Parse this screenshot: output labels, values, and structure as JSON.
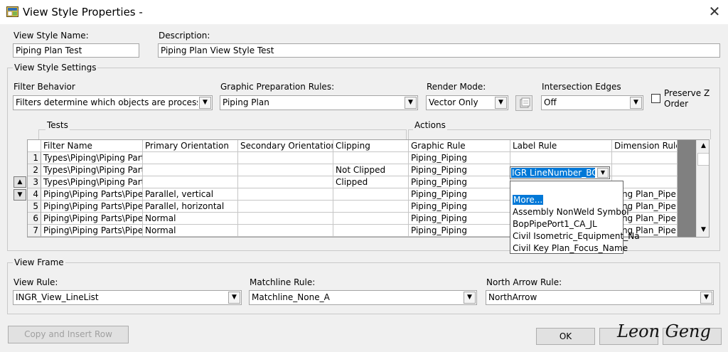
{
  "window": {
    "title": "View Style Properties -",
    "close_glyph": "✕"
  },
  "header": {
    "name_label": "View Style Name:",
    "name_value": "Piping Plan Test",
    "desc_label": "Description:",
    "desc_value": "Piping Plan View Style Test"
  },
  "settings": {
    "group_label": "View Style Settings",
    "filter_behavior_label": "Filter Behavior",
    "filter_behavior_value": "Filters determine which objects are processed (V",
    "graphic_prep_label": "Graphic Preparation Rules:",
    "graphic_prep_value": "Piping Plan",
    "render_mode_label": "Render Mode:",
    "render_mode_value": "Vector Only",
    "intersection_label": "Intersection Edges",
    "intersection_value": "Off",
    "preserve_z_label_1": "Preserve Z",
    "preserve_z_label_2": "Order"
  },
  "grid": {
    "tests_label": "Tests",
    "actions_label": "Actions",
    "columns": [
      "Filter Name",
      "Primary Orientation",
      "Secondary Orientation",
      "Clipping",
      "Graphic Rule",
      "Label Rule",
      "Dimension Rule"
    ],
    "rows": [
      {
        "num": "1",
        "filter": "Types\\Piping\\Piping Parts",
        "primary": "",
        "secondary": "",
        "clipping": "",
        "graphic": "Piping_Piping",
        "label": "",
        "dimension": ""
      },
      {
        "num": "2",
        "filter": "Types\\Piping\\Piping Parts",
        "primary": "",
        "secondary": "",
        "clipping": "Not Clipped",
        "graphic": "Piping_Piping",
        "label": "",
        "dimension": ""
      },
      {
        "num": "3",
        "filter": "Types\\Piping\\Piping Parts",
        "primary": "",
        "secondary": "",
        "clipping": "Clipped",
        "graphic": "Piping_Piping",
        "label": "",
        "dimension": ""
      },
      {
        "num": "4",
        "filter": "Piping\\Piping Parts\\Pipes",
        "primary": "Parallel, vertical",
        "secondary": "",
        "clipping": "",
        "graphic": "Piping_Piping",
        "label": "",
        "dimension": "ping Plan_Pipe"
      },
      {
        "num": "5",
        "filter": "Piping\\Piping Parts\\Pipes",
        "primary": "Parallel, horizontal",
        "secondary": "",
        "clipping": "",
        "graphic": "Piping_Piping",
        "label": "",
        "dimension": "ping Plan_Pipe"
      },
      {
        "num": "6",
        "filter": "Piping\\Piping Parts\\Pipes",
        "primary": "Normal",
        "secondary": "",
        "clipping": "",
        "graphic": "Piping_Piping",
        "label": "",
        "dimension": "ping Plan_Pipe"
      },
      {
        "num": "7",
        "filter": "Piping\\Piping Parts\\Pipes",
        "primary": "Normal",
        "secondary": "",
        "clipping": "",
        "graphic": "Piping_Piping",
        "label": "",
        "dimension": "ping Plan_Pipe"
      }
    ],
    "active_label_value": "IGR LineNumber_BOP",
    "dropdown_options": [
      "More...",
      "Assembly NonWeld Symbol",
      "BopPipePort1_CA_JL",
      "Civil Isometric_Equipment_Na",
      "Civil Key Plan_Focus_Name"
    ]
  },
  "view_frame": {
    "group_label": "View Frame",
    "view_rule_label": "View Rule:",
    "view_rule_value": "INGR_View_LineList",
    "matchline_label": "Matchline Rule:",
    "matchline_value": "Matchline_None_A",
    "north_arrow_label": "North Arrow Rule:",
    "north_arrow_value": "NorthArrow"
  },
  "footer": {
    "copy_insert_label": "Copy and Insert Row",
    "ok_label": "OK",
    "watermark": "Leon Geng"
  },
  "colors": {
    "selection": "#0078d7",
    "window_bg": "#f0f0f0"
  }
}
